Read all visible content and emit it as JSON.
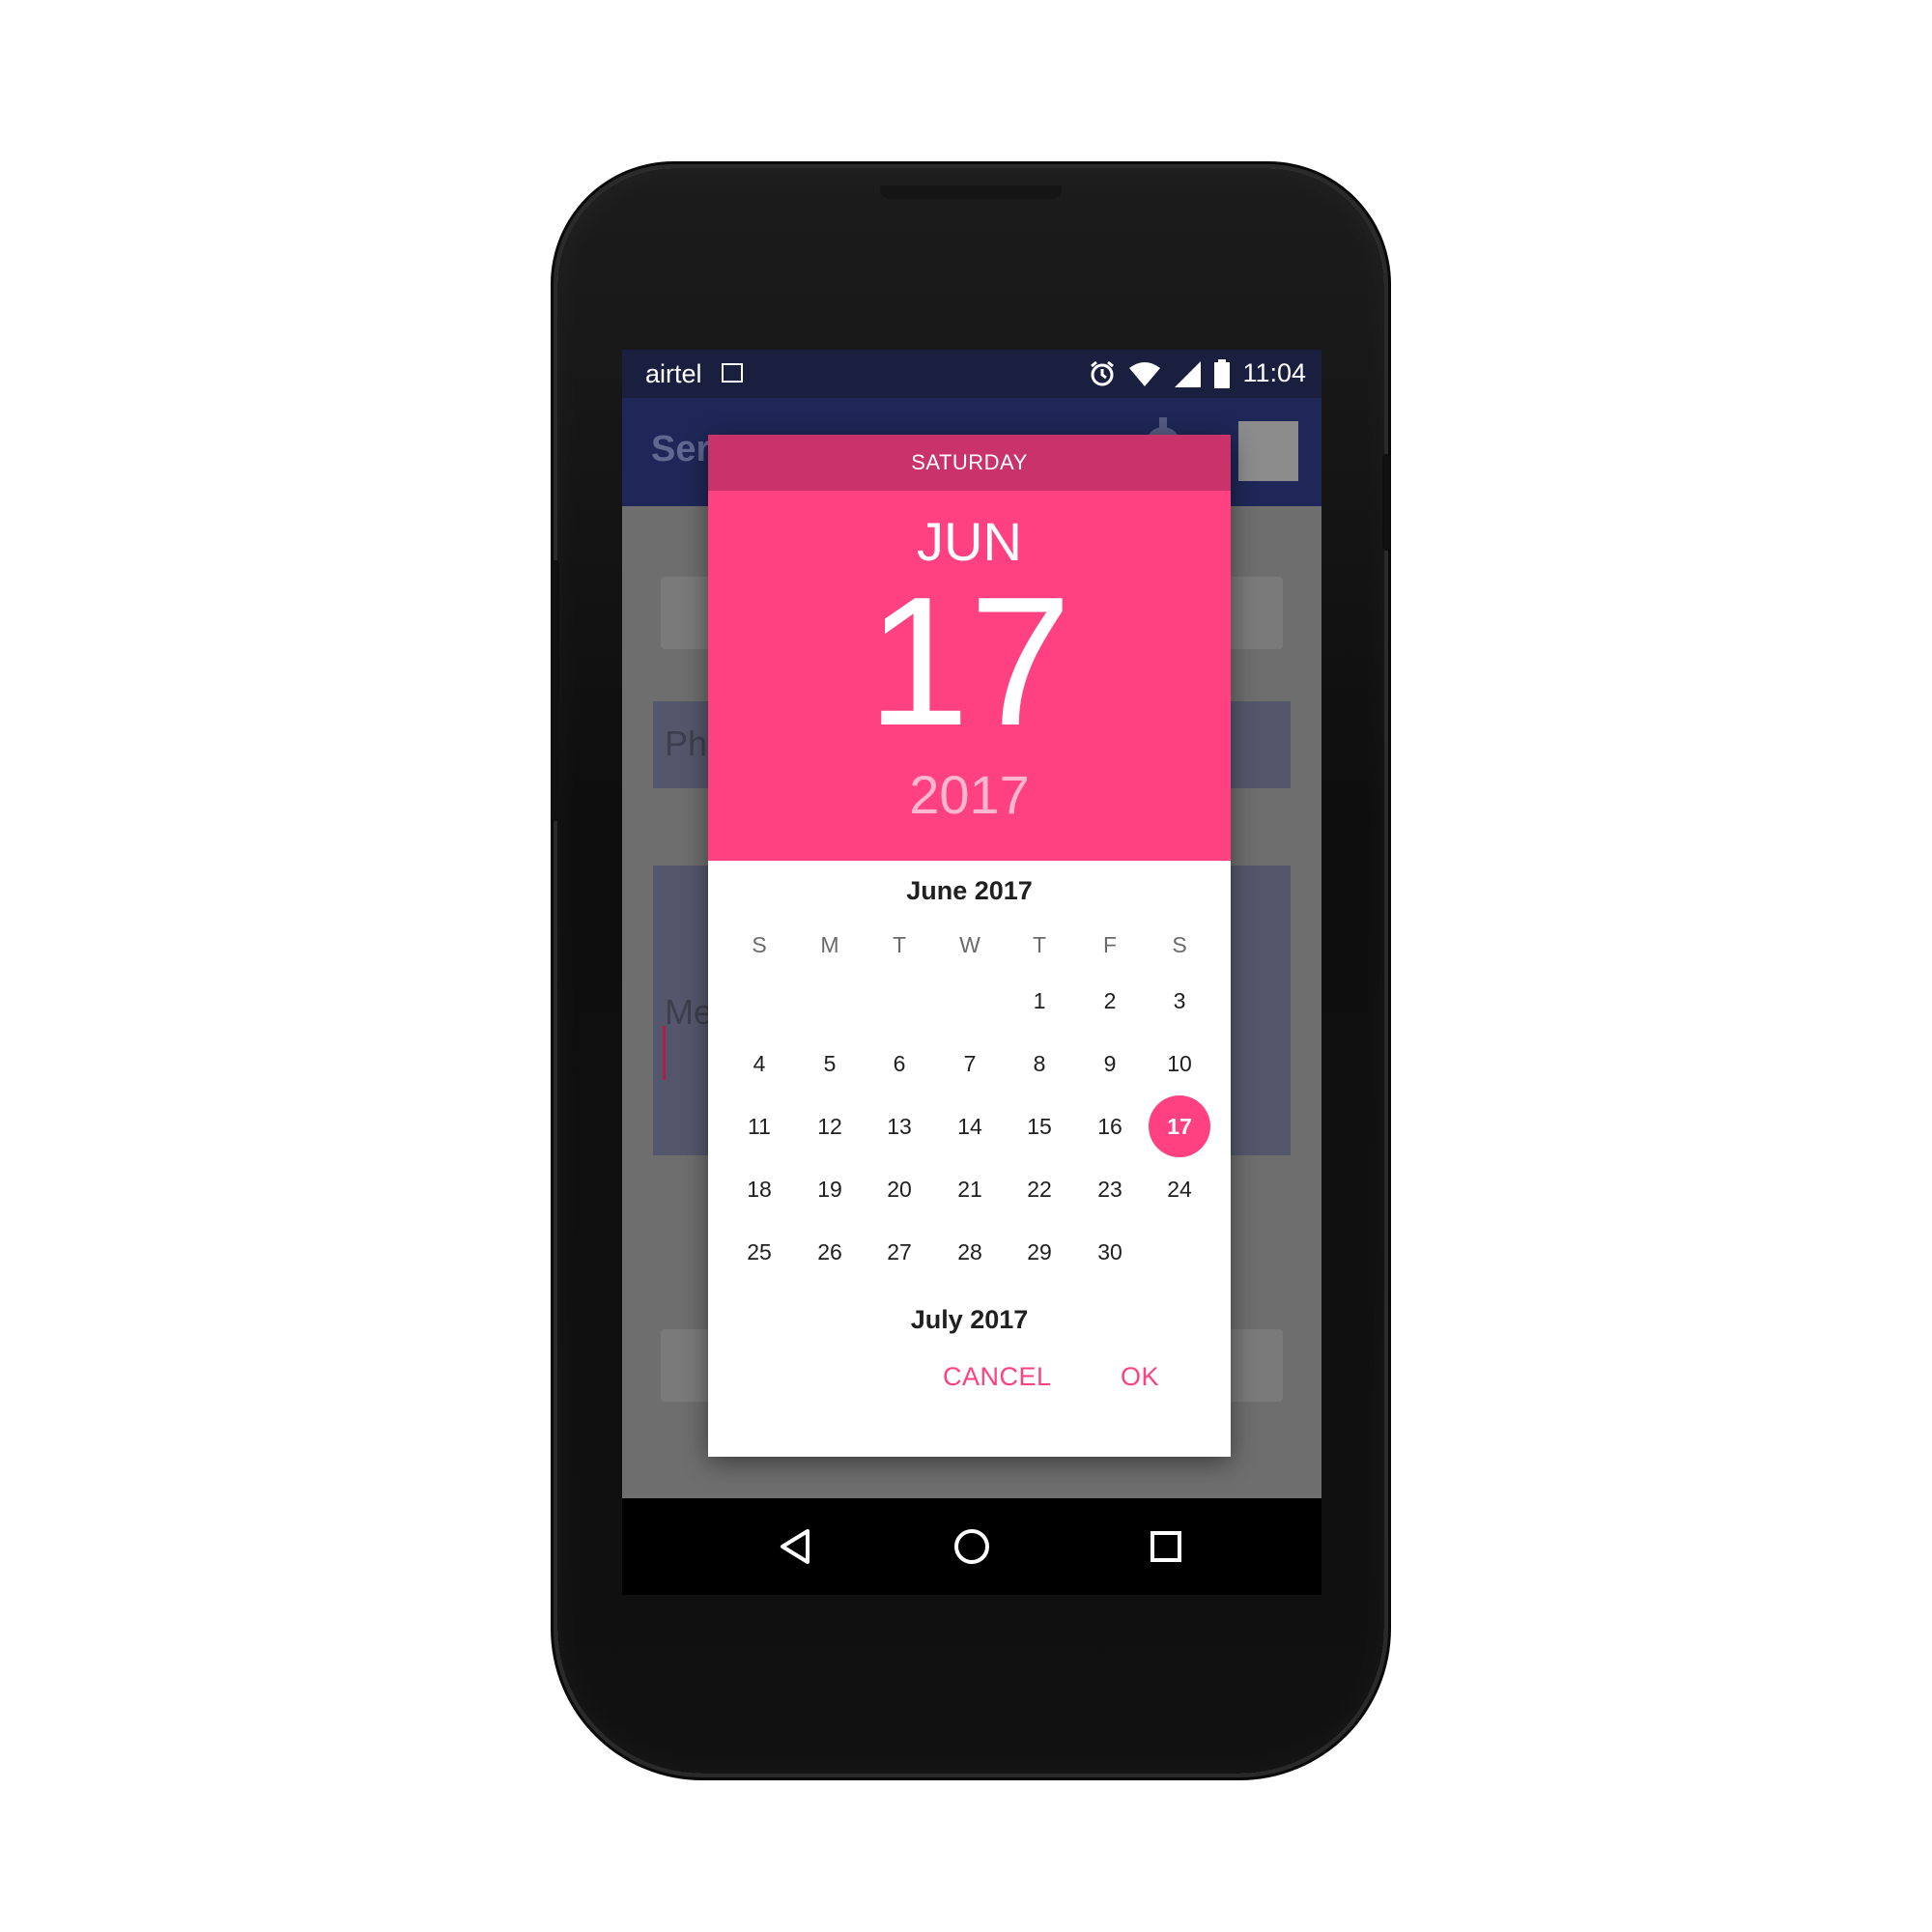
{
  "status_bar": {
    "carrier": "airtel",
    "time": "11:04"
  },
  "app": {
    "title_partial": "Ser",
    "phone_placeholder_partial": "Ph",
    "message_placeholder_partial": "Me"
  },
  "dialog": {
    "day_of_week": "SATURDAY",
    "month": "JUN",
    "day": "17",
    "year": "2017",
    "current_month_label": "June 2017",
    "next_month_label": "July 2017",
    "weekdays": [
      "S",
      "M",
      "T",
      "W",
      "T",
      "F",
      "S"
    ],
    "weeks": [
      [
        "",
        "",
        "",
        "",
        "1",
        "2",
        "3"
      ],
      [
        "4",
        "5",
        "6",
        "7",
        "8",
        "9",
        "10"
      ],
      [
        "11",
        "12",
        "13",
        "14",
        "15",
        "16",
        "17"
      ],
      [
        "18",
        "19",
        "20",
        "21",
        "22",
        "23",
        "24"
      ],
      [
        "25",
        "26",
        "27",
        "28",
        "29",
        "30",
        ""
      ]
    ],
    "selected_day": "17",
    "cancel_label": "CANCEL",
    "ok_label": "OK"
  },
  "colors": {
    "accent": "#ff4081",
    "accent_dark": "#c9336a",
    "status_bar": "#1a1f40",
    "toolbar": "#1e2757"
  }
}
